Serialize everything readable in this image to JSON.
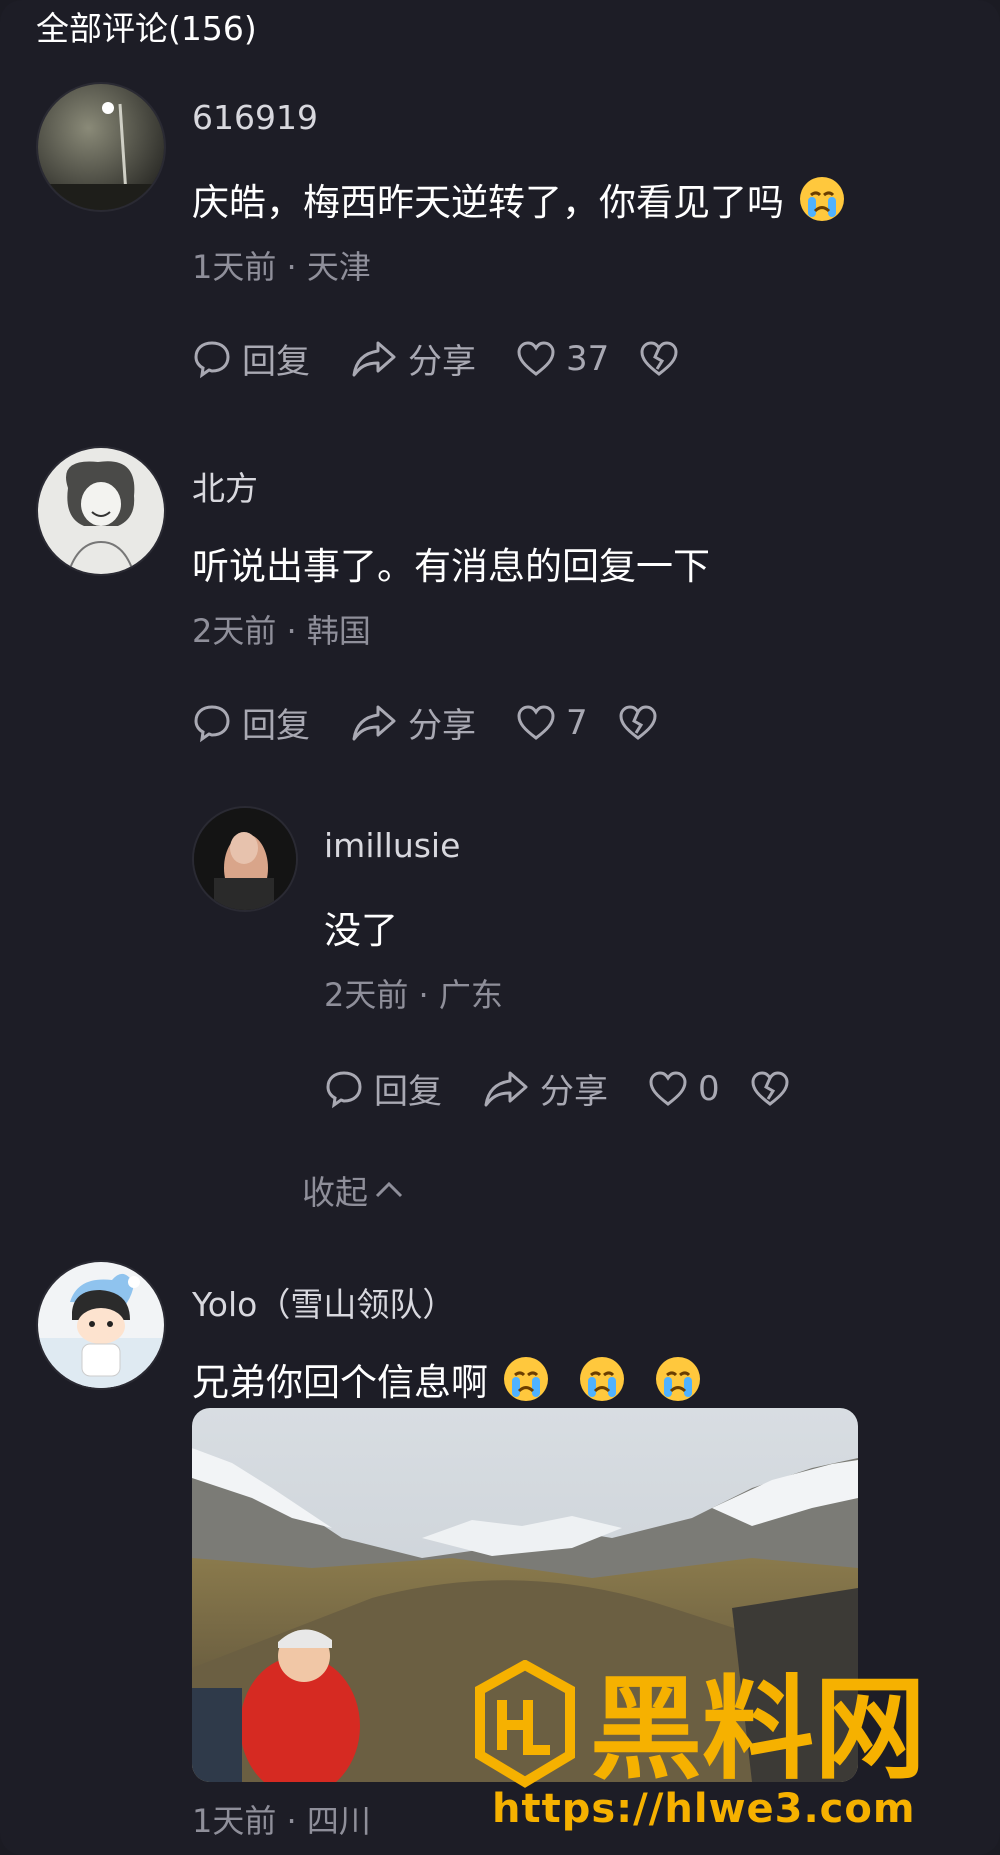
{
  "header": {
    "title": "全部评论(156)"
  },
  "comments": [
    {
      "username": "616919",
      "text": "庆皓，梅西昨天逆转了，你看见了吗",
      "meta": "1天前 · 天津",
      "reply_label": "回复",
      "share_label": "分享",
      "likes": "37"
    },
    {
      "username": "北方",
      "text": "听说出事了。有消息的回复一下",
      "meta": "2天前 · 韩国",
      "reply_label": "回复",
      "share_label": "分享",
      "likes": "7"
    },
    {
      "username": "imillusie",
      "text": "没了",
      "meta": "2天前 · 广东",
      "reply_label": "回复",
      "share_label": "分享",
      "likes": "0"
    },
    {
      "username": "Yolo（雪山领队）",
      "text": "兄弟你回个信息啊",
      "meta": "1天前 · 四川"
    }
  ],
  "collapse_label": "收起",
  "icons": {
    "comment": "speech-bubble-icon",
    "share": "share-arrow-icon",
    "like": "heart-icon",
    "dislike": "broken-heart-icon",
    "emoji": "crying-face-emoji"
  },
  "watermark": {
    "logo_text": "黑料网",
    "url": "https://hlwe3.com"
  },
  "colors": {
    "background": "#1d1d26",
    "accent": "#f6b100"
  }
}
